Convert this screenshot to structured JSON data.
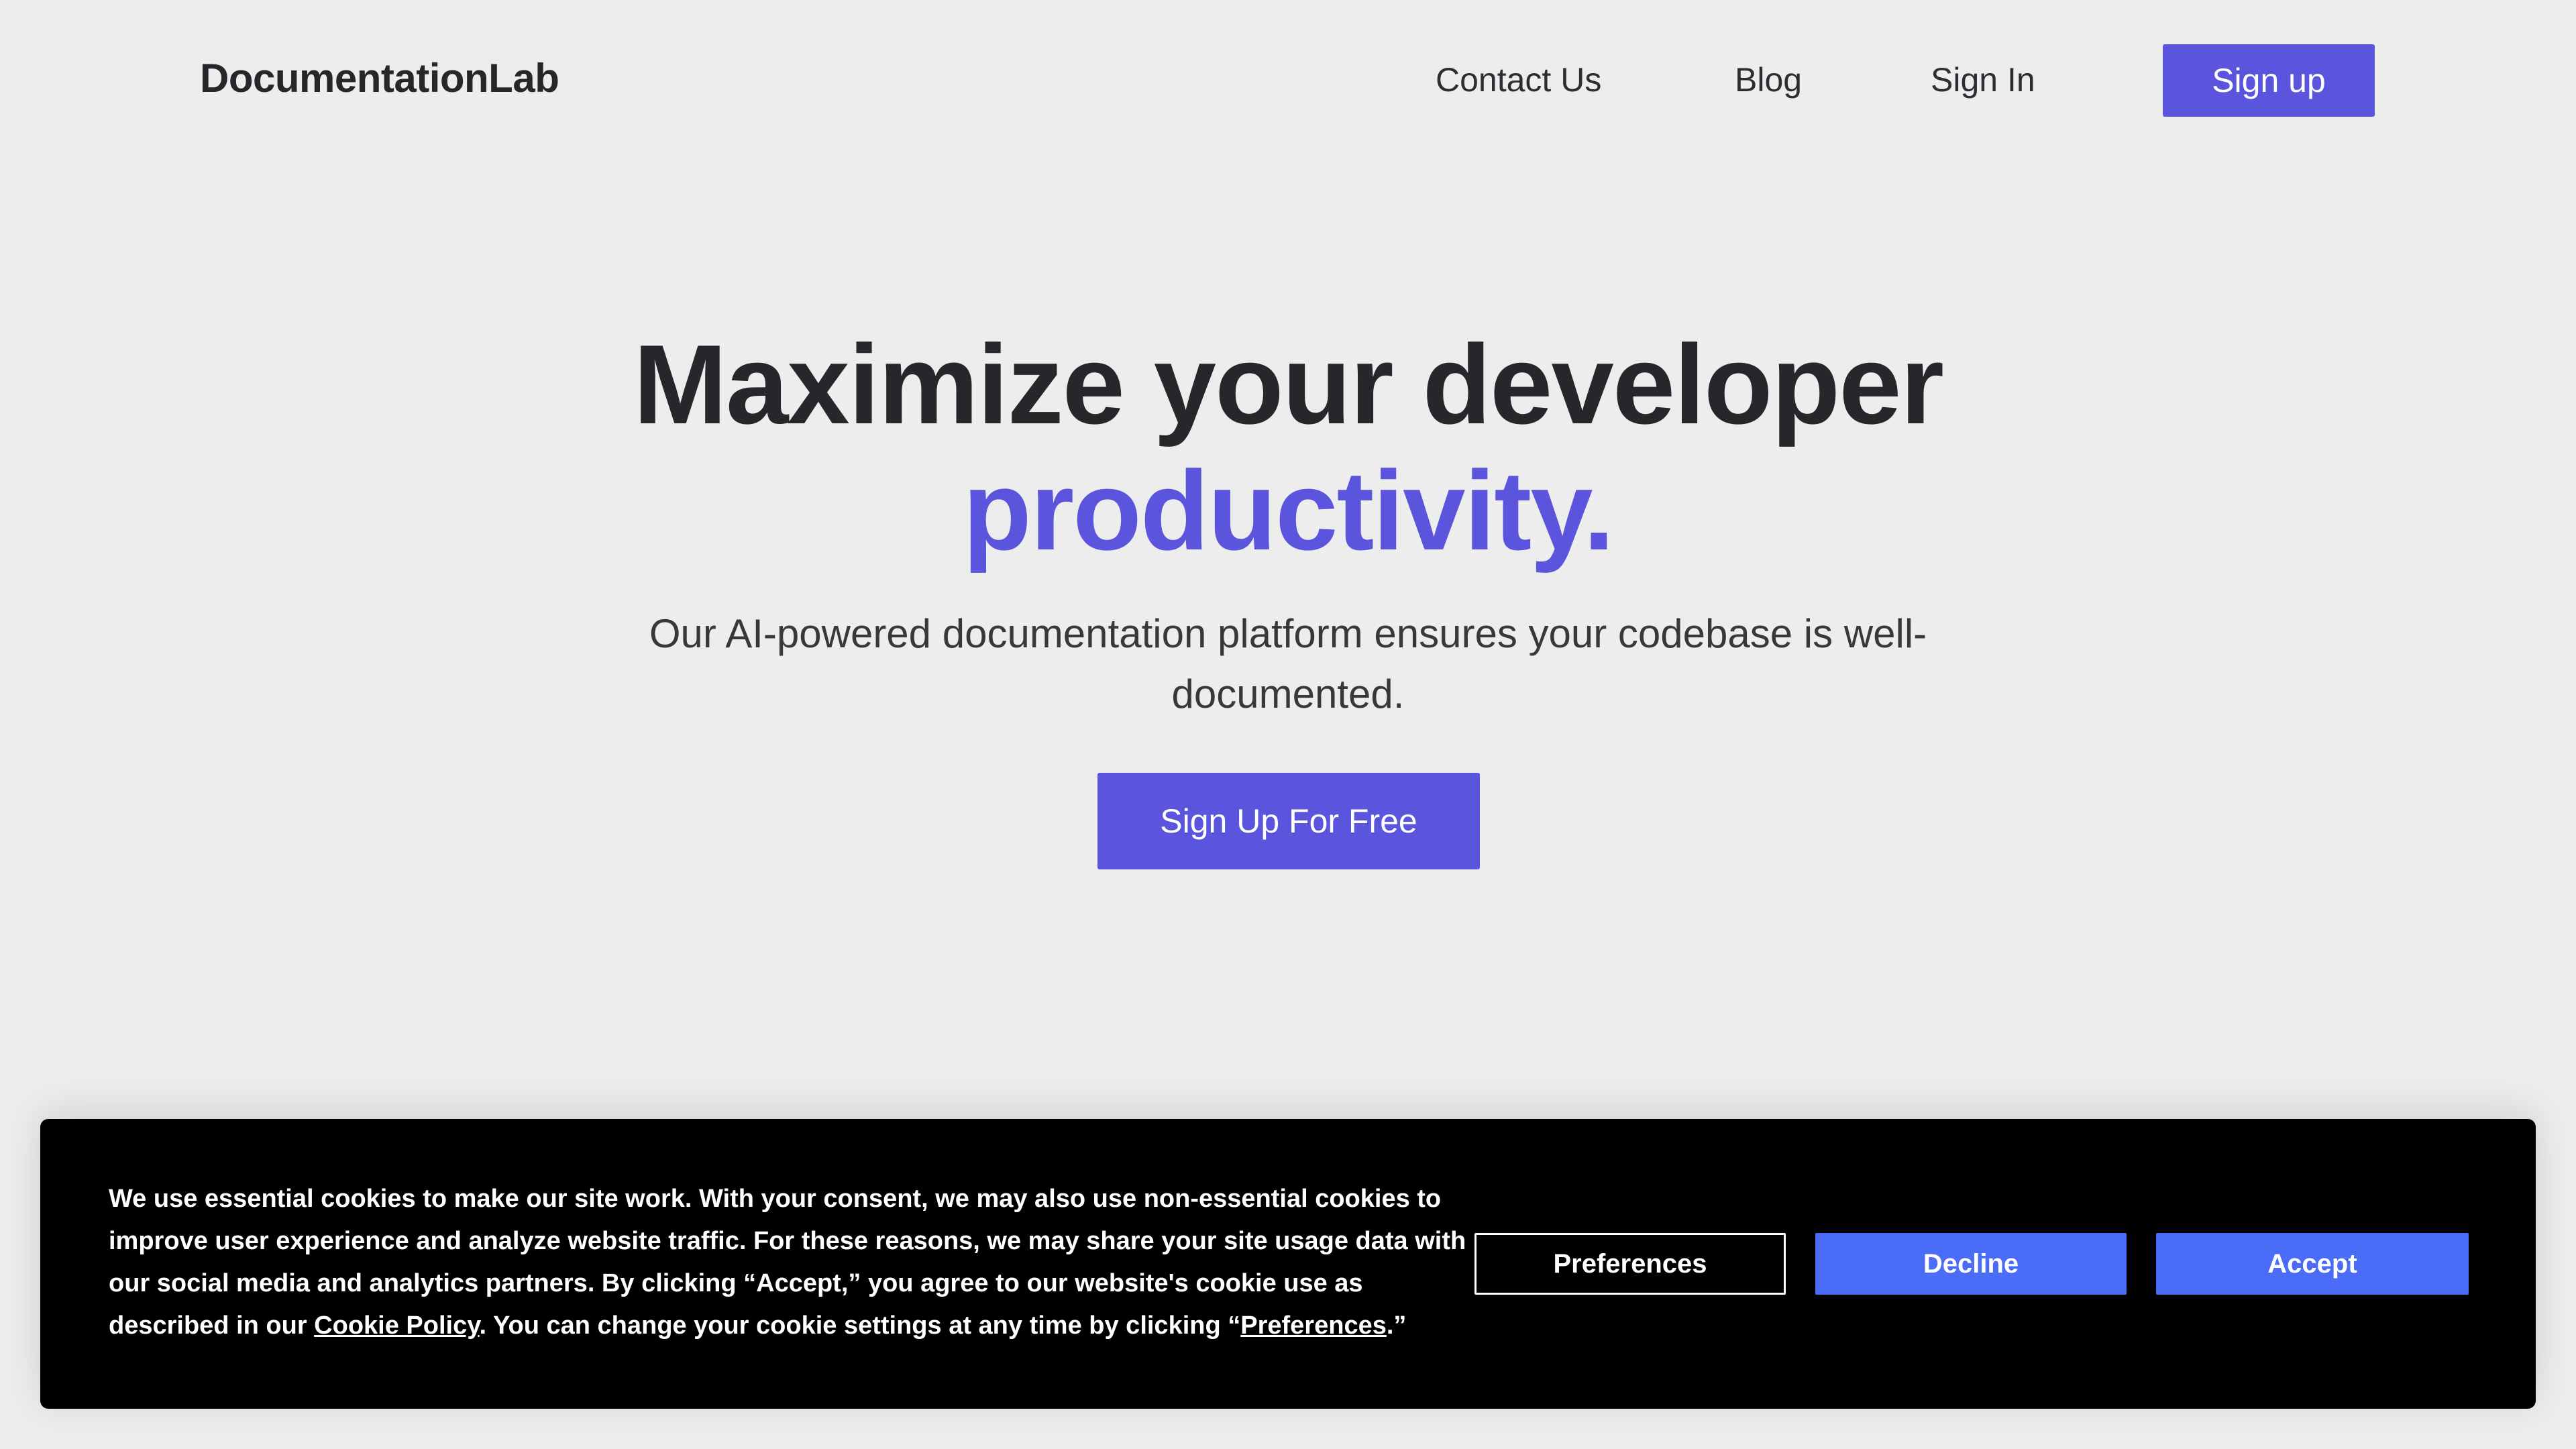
{
  "header": {
    "logo": "DocumentationLab",
    "nav": {
      "contact": "Contact Us",
      "blog": "Blog",
      "sign_in": "Sign In",
      "sign_up": "Sign up"
    }
  },
  "hero": {
    "title": "Maximize your developer",
    "title_accent": "productivity.",
    "subtitle": "Our AI-powered documentation platform ensures your codebase is well-documented.",
    "cta": "Sign Up For Free"
  },
  "cookie_banner": {
    "text_1": "We use essential cookies to make our site work. With your consent, we may also use non-essential cookies to improve user experience and analyze website traffic. For these reasons, we may share your site usage data with our social media and analytics partners. By clicking “Accept,” you agree to our website's cookie use as described in our ",
    "cookie_policy_link": "Cookie Policy",
    "text_2": ". You can change your cookie settings at any time by clicking “",
    "preferences_link": "Preferences",
    "text_3": ".”",
    "buttons": {
      "preferences": "Preferences",
      "decline": "Decline",
      "accept": "Accept"
    }
  },
  "colors": {
    "brand_accent": "#5a55dc",
    "cookie_button": "#4a6cf7",
    "background": "#ededed",
    "banner": "#000000"
  }
}
